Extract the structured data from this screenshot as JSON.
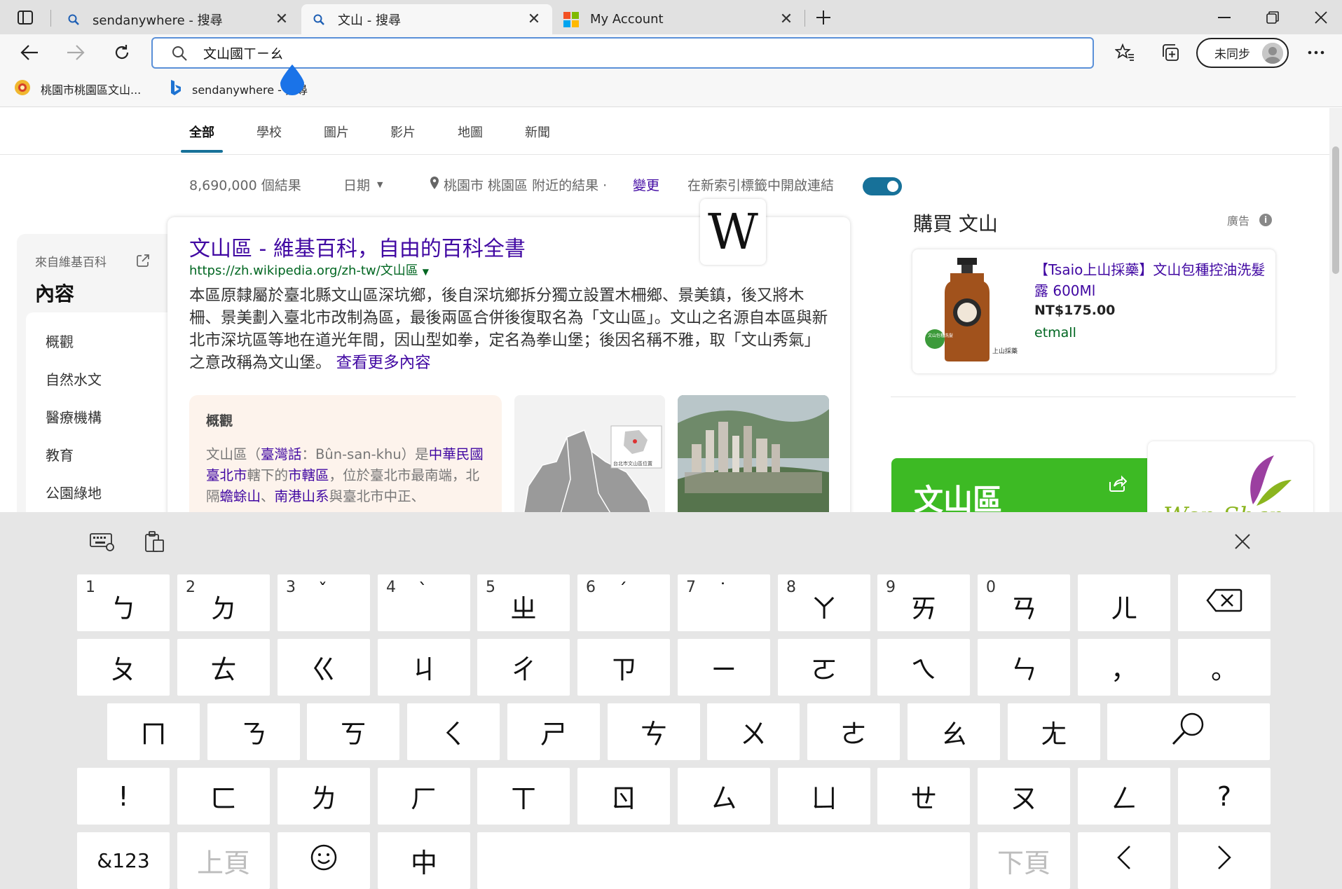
{
  "browser": {
    "tabs": [
      {
        "title": "sendanywhere - 搜尋",
        "active": false
      },
      {
        "title": "文山 - 搜尋",
        "active": true
      },
      {
        "title": "My Account",
        "active": false
      }
    ],
    "address_bar": {
      "value": "文山國ㄒㄧㄠ"
    },
    "sync_label": "未同步",
    "favorites": [
      "桃園市桃園區文山...",
      "sendanywhere - 搜尋"
    ]
  },
  "search": {
    "scopes": [
      "全部",
      "學校",
      "圖片",
      "影片",
      "地圖",
      "新聞"
    ],
    "result_count": "8,690,000 個結果",
    "date_filter": "日期",
    "location_text": "桃園市 桃園區 附近的結果 ·",
    "location_change": "變更",
    "new_tab_toggle_label": "在新索引標籤中開啟連結",
    "new_tab_toggle_on": true
  },
  "toc": {
    "source": "來自維基百科",
    "heading": "內容",
    "items": [
      "概觀",
      "自然水文",
      "醫療機構",
      "教育",
      "公園綠地"
    ]
  },
  "wiki": {
    "title": "文山區 - 維基百科，自由的百科全書",
    "url": "https://zh.wikipedia.org/zh-tw/文山區",
    "logo_letter": "W",
    "snippet": "本區原隸屬於臺北縣文山區深坑鄉，後自深坑鄉拆分獨立設置木柵鄉、景美鎮，後又將木柵、景美劃入臺北市改制為區，最後兩區合併後復取名為「文山區」。文山之名源自本區與新北市深坑區等地在道光年間，因山型如拳，定名為拳山堡；後因名稱不雅，取「文山秀氣」之意改稱為文山堡。",
    "more_link": "查看更多內容",
    "overview_title": "概觀",
    "overview_parts": [
      "文山區（",
      "臺灣話",
      "：Bûn-san-khu）是",
      "中華民國臺北市",
      "轄下的",
      "市轄區",
      "，位於臺北市最南端，北隔",
      "蟾蜍山",
      "、",
      "南港山系",
      "與臺北市中正、"
    ],
    "map_caption": "台北市文山區位置"
  },
  "shopping": {
    "title": "購買 文山",
    "ad_label": "廣告",
    "product_name": "【Tsaio上山採藥】文山包種控油洗髮露 600Ml",
    "price": "NT$175.00",
    "store": "etmall",
    "bottle_badge": "文山包種洗髮",
    "bottle_brand": "上山採藥"
  },
  "entity_card": {
    "title": "文山區",
    "logo_text": "Wen Shan"
  },
  "keyboard": {
    "row1": [
      {
        "num": "1",
        "sym": "",
        "main": "ㄅ"
      },
      {
        "num": "2",
        "sym": "",
        "main": "ㄉ"
      },
      {
        "num": "3",
        "sym": "ˇ",
        "main": ""
      },
      {
        "num": "4",
        "sym": "ˋ",
        "main": ""
      },
      {
        "num": "5",
        "sym": "",
        "main": "ㄓ"
      },
      {
        "num": "6",
        "sym": "ˊ",
        "main": ""
      },
      {
        "num": "7",
        "sym": "˙",
        "main": ""
      },
      {
        "num": "8",
        "sym": "",
        "main": "ㄚ"
      },
      {
        "num": "9",
        "sym": "",
        "main": "ㄞ"
      },
      {
        "num": "0",
        "sym": "",
        "main": "ㄢ"
      },
      {
        "num": "",
        "sym": "",
        "main": "ㄦ"
      }
    ],
    "row2": [
      "ㄆ",
      "ㄊ",
      "ㄍ",
      "ㄐ",
      "ㄔ",
      "ㄗ",
      "ㄧ",
      "ㄛ",
      "ㄟ",
      "ㄣ",
      "，",
      "。"
    ],
    "row3": [
      "ㄇ",
      "ㄋ",
      "ㄎ",
      "ㄑ",
      "ㄕ",
      "ㄘ",
      "ㄨ",
      "ㄜ",
      "ㄠ",
      "ㄤ"
    ],
    "row4": [
      "!",
      "ㄈ",
      "ㄌ",
      "ㄏ",
      "ㄒ",
      "ㄖ",
      "ㄙ",
      "ㄩ",
      "ㄝ",
      "ㄡ",
      "ㄥ",
      "?"
    ],
    "row5": {
      "sym_key": "&123",
      "prev_page": "上頁",
      "ime_mode": "中",
      "next_page": "下頁",
      "left": "‹",
      "right": "›"
    }
  },
  "colors": {
    "accent": "#177199",
    "link": "#4007a2",
    "url_green": "#006621",
    "entity_green": "#3dba24",
    "drop": "#1a73e8"
  }
}
